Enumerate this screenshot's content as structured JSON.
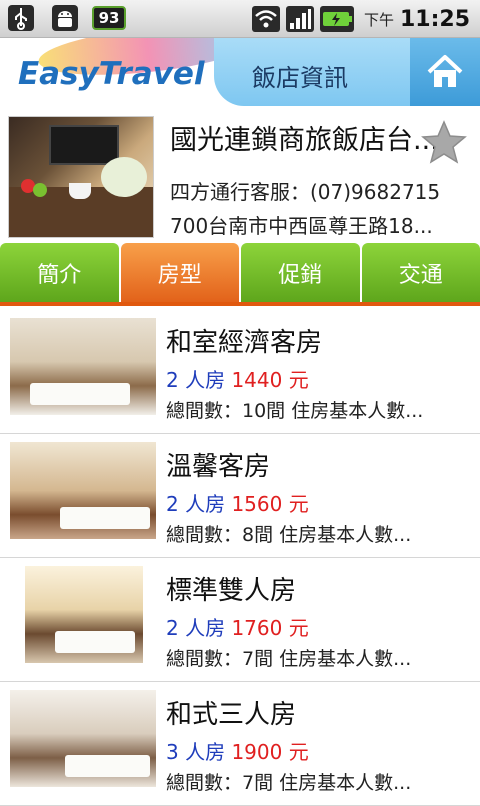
{
  "status_bar": {
    "battery_level": "93",
    "ampm": "下午",
    "time": "11:25"
  },
  "header": {
    "logo": "EasyTravel",
    "title": "飯店資訊"
  },
  "hotel": {
    "name": "國光連鎖商旅飯店台...",
    "phone": "四方通行客服：(07)9682715",
    "address": "700台南市中西區尊王路18..."
  },
  "tabs": [
    {
      "label": "簡介",
      "active": false
    },
    {
      "label": "房型",
      "active": true
    },
    {
      "label": "促銷",
      "active": false
    },
    {
      "label": "交通",
      "active": false
    }
  ],
  "rooms": [
    {
      "name": "和室經濟客房",
      "capacity": "2 人房",
      "price": "1440 元",
      "info": "總間數：10間 住房基本人數..."
    },
    {
      "name": "溫馨客房",
      "capacity": "2 人房",
      "price": "1560 元",
      "info": "總間數：8間 住房基本人數..."
    },
    {
      "name": "標準雙人房",
      "capacity": "2 人房",
      "price": "1760 元",
      "info": "總間數：7間 住房基本人數..."
    },
    {
      "name": "和式三人房",
      "capacity": "3 人房",
      "price": "1900 元",
      "info": "總間數：7間 住房基本人數..."
    }
  ],
  "colors": {
    "tab_green": "#6cb524",
    "tab_orange": "#ef7a2a",
    "capacity_blue": "#1f3dbb",
    "price_red": "#e02020",
    "header_blue": "#7ec7f1"
  }
}
